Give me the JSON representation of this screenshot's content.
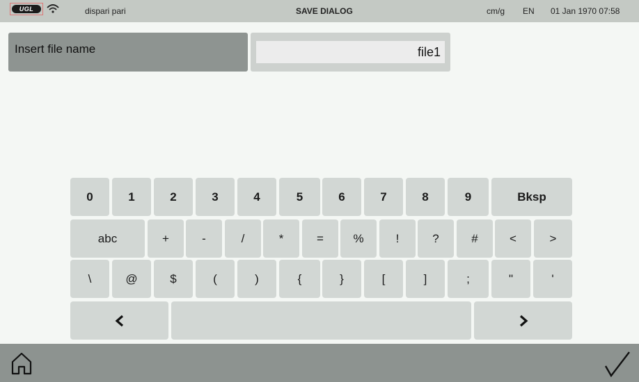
{
  "status_bar": {
    "logo_text": "UGL",
    "mode": "dispari pari",
    "title": "SAVE DIALOG",
    "units": "cm/g",
    "language": "EN",
    "datetime": "01 Jan 1970 07:58",
    "icons": [
      "wifi-icon"
    ]
  },
  "file_name": {
    "label": "Insert file name",
    "value": "file1"
  },
  "keyboard": {
    "row1": [
      "0",
      "1",
      "2",
      "3",
      "4",
      "5",
      "6",
      "7",
      "8",
      "9",
      "Bksp"
    ],
    "row2": [
      "abc",
      "+",
      "-",
      "/",
      "*",
      "=",
      "%",
      "!",
      "?",
      "#",
      "<",
      ">"
    ],
    "row3": [
      "\\",
      "@",
      "$",
      "(",
      ")",
      "{",
      "}",
      "[",
      "]",
      ";",
      "\"",
      "'"
    ],
    "row4": {
      "left_icon": "chevron-left-icon",
      "space": "",
      "right_icon": "chevron-right-icon"
    }
  },
  "bottom_bar": {
    "left_icon": "home-icon",
    "right_icon": "checkmark-icon"
  }
}
